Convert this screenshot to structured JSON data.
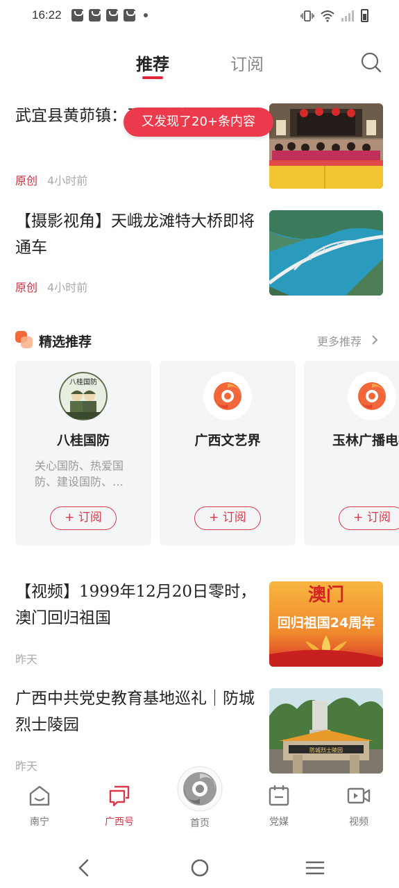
{
  "status_bar": {
    "time": "16:22",
    "notification_icons": [
      "shopping-bag-icon",
      "shopping-bag-icon",
      "shopping-bag-icon",
      "shopping-bag-icon",
      "dot-icon"
    ],
    "system_icons": [
      "vibrate-icon",
      "wifi-icon",
      "signal-icon",
      "battery-icon"
    ]
  },
  "top_nav": {
    "tabs": [
      {
        "label": "推荐",
        "active": true
      },
      {
        "label": "订阅",
        "active": false
      }
    ],
    "search_icon": "search-icon",
    "accent_color": "#e0243a"
  },
  "toast": {
    "text": "又发现了20+条内容"
  },
  "articles_top": [
    {
      "title": "武宜县黄茆镇：开展传统习俗活",
      "tag": "原创",
      "time": "4小时前"
    },
    {
      "title": "【摄影视角】天峨龙滩特大桥即将通车",
      "tag": "原创",
      "time": "4小时前"
    }
  ],
  "featured": {
    "title": "精选推荐",
    "more": "更多推荐",
    "cards": [
      {
        "name": "八桂国防",
        "desc": "关心国防、热爱国防、建设国防、…",
        "avatar_text": "八桂国防",
        "button": "+ 订阅"
      },
      {
        "name": "广西文艺界",
        "desc": "",
        "button": "+ 订阅"
      },
      {
        "name": "玉林广播电视",
        "desc": "",
        "button": "+ 订阅"
      }
    ]
  },
  "articles_bottom": [
    {
      "title": "【视频】1999年12月20日零时，澳门回归祖国",
      "time": "昨天",
      "thumb_text": {
        "top": "澳门",
        "main": "回归祖国24周年"
      }
    },
    {
      "title": "广西中共党史教育基地巡礼｜防城烈士陵园",
      "time": "昨天",
      "thumb_text": {
        "sign": "防城烈士陵园"
      }
    }
  ],
  "bottom_nav": {
    "items": [
      {
        "label": "南宁",
        "icon": "home-outline-icon",
        "active": false
      },
      {
        "label": "广西号",
        "icon": "chat-bubbles-icon",
        "active": true
      },
      {
        "label": "首页",
        "icon": "swirl-logo-icon",
        "active": false
      },
      {
        "label": "党媒",
        "icon": "calendar-icon",
        "active": false
      },
      {
        "label": "视频",
        "icon": "video-camera-icon",
        "active": false
      }
    ],
    "active_color": "#d8384a"
  },
  "system_nav": {
    "buttons": [
      "back-icon",
      "home-circle-icon",
      "menu-icon"
    ]
  }
}
